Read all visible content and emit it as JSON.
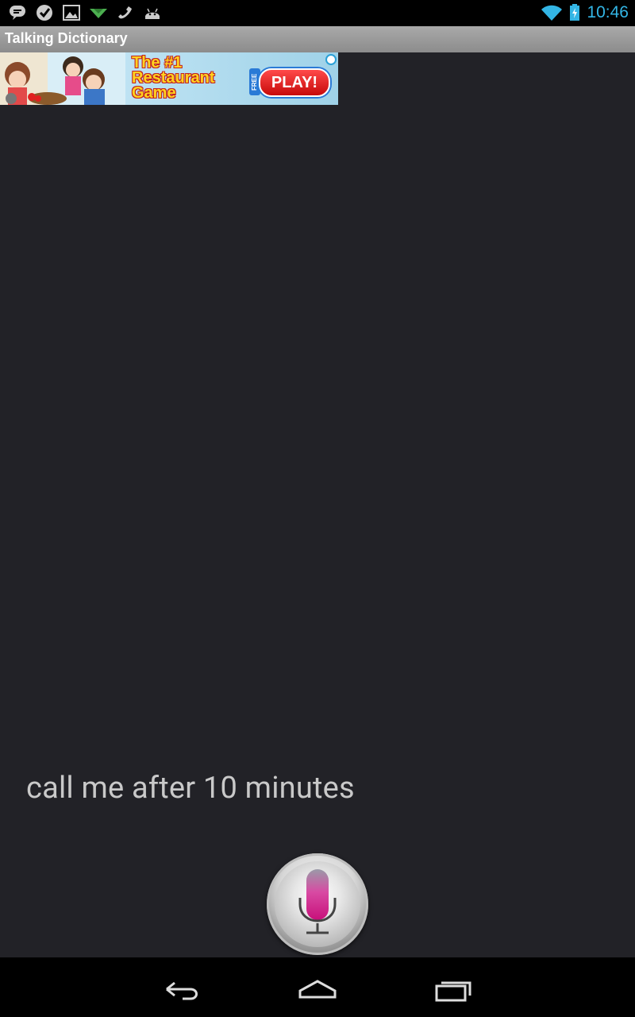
{
  "status_bar": {
    "time": "10:46",
    "notification_icons": [
      "talk-icon",
      "tasks-icon",
      "gallery-icon",
      "download-icon",
      "phone-icon",
      "android-icon"
    ],
    "accent_color": "#33b5e5"
  },
  "app": {
    "title": "Talking Dictionary"
  },
  "ad": {
    "headline": "The #1 Restaurant Game",
    "free_label": "FREE",
    "cta": "PLAY!"
  },
  "transcript": {
    "text": "call me after 10 minutes"
  },
  "mic_button": {
    "icon": "microphone-icon"
  },
  "nav_bar": {
    "buttons": [
      "back",
      "home",
      "recent-apps"
    ]
  }
}
